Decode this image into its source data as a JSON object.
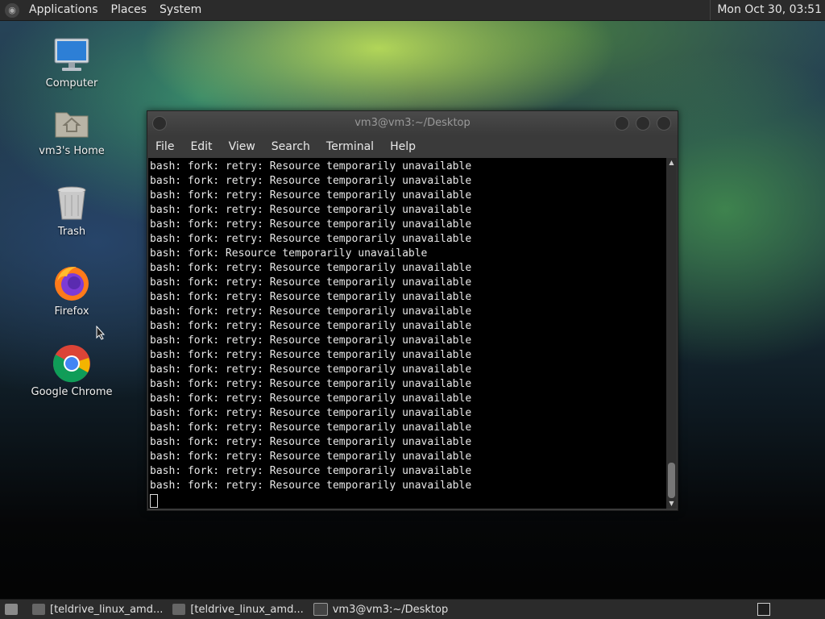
{
  "top_panel": {
    "menus": [
      "Applications",
      "Places",
      "System"
    ],
    "clock": "Mon Oct 30, 03:51"
  },
  "desktop_icons": [
    {
      "label": "Computer",
      "icon": "computer-icon"
    },
    {
      "label": "vm3's Home",
      "icon": "home-folder-icon"
    },
    {
      "label": "Trash",
      "icon": "trash-icon"
    },
    {
      "label": "Firefox",
      "icon": "firefox-icon"
    },
    {
      "label": "Google Chrome",
      "icon": "chrome-icon"
    }
  ],
  "terminal": {
    "title": "vm3@vm3:~/Desktop",
    "menus": [
      "File",
      "Edit",
      "View",
      "Search",
      "Terminal",
      "Help"
    ],
    "lines": [
      "bash: fork: retry: Resource temporarily unavailable",
      "bash: fork: retry: Resource temporarily unavailable",
      "bash: fork: retry: Resource temporarily unavailable",
      "bash: fork: retry: Resource temporarily unavailable",
      "bash: fork: retry: Resource temporarily unavailable",
      "bash: fork: retry: Resource temporarily unavailable",
      "bash: fork: Resource temporarily unavailable",
      "bash: fork: retry: Resource temporarily unavailable",
      "bash: fork: retry: Resource temporarily unavailable",
      "bash: fork: retry: Resource temporarily unavailable",
      "bash: fork: retry: Resource temporarily unavailable",
      "bash: fork: retry: Resource temporarily unavailable",
      "bash: fork: retry: Resource temporarily unavailable",
      "bash: fork: retry: Resource temporarily unavailable",
      "bash: fork: retry: Resource temporarily unavailable",
      "bash: fork: retry: Resource temporarily unavailable",
      "bash: fork: retry: Resource temporarily unavailable",
      "bash: fork: retry: Resource temporarily unavailable",
      "bash: fork: retry: Resource temporarily unavailable",
      "bash: fork: retry: Resource temporarily unavailable",
      "bash: fork: retry: Resource temporarily unavailable",
      "bash: fork: retry: Resource temporarily unavailable",
      "bash: fork: retry: Resource temporarily unavailable"
    ]
  },
  "taskbar": {
    "tasks": [
      {
        "label": "[teldrive_linux_amd...",
        "icon": "folder-icon"
      },
      {
        "label": "[teldrive_linux_amd...",
        "icon": "folder-icon"
      },
      {
        "label": "vm3@vm3:~/Desktop",
        "icon": "terminal-icon"
      }
    ]
  }
}
